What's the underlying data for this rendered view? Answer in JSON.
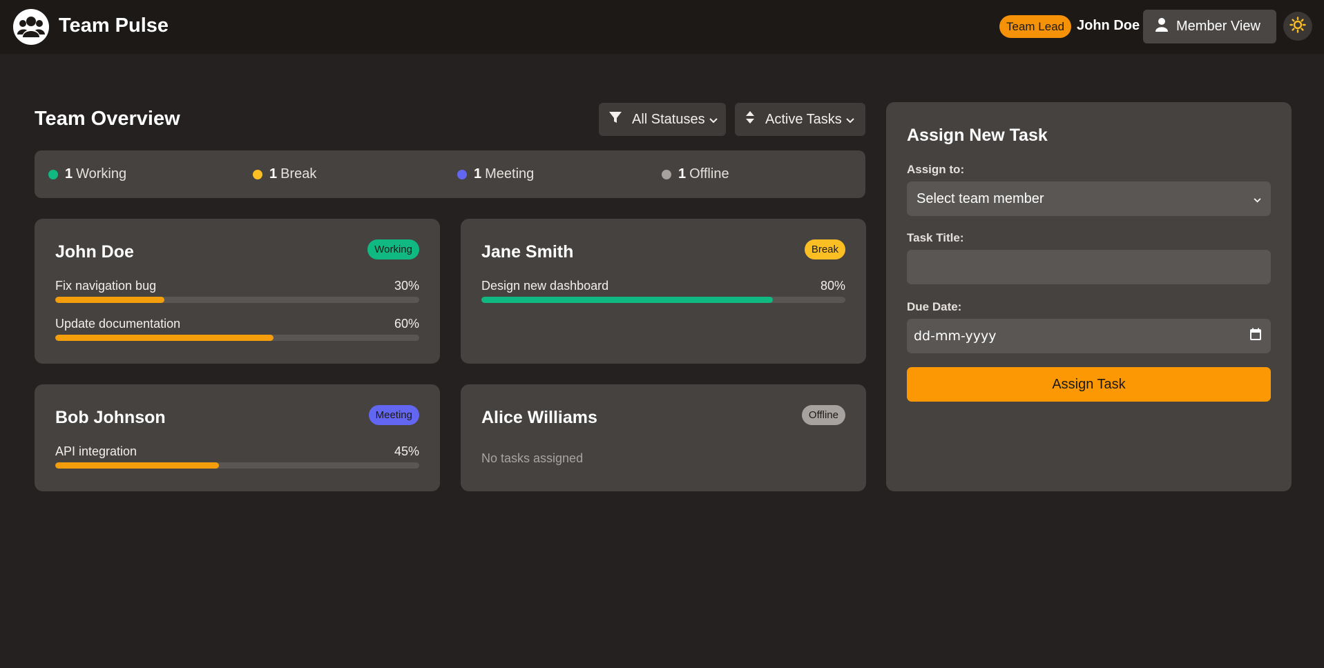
{
  "header": {
    "app_title": "Team Pulse",
    "role_badge": "Team Lead",
    "user_name": "John Doe",
    "view_button_label": "Member View",
    "icons": {
      "logo": "users-icon",
      "view": "user-icon",
      "theme": "sun-icon"
    }
  },
  "overview": {
    "title": "Team Overview",
    "filter_status_label": "All Statuses",
    "filter_sort_label": "Active Tasks",
    "summary": [
      {
        "count": "1",
        "label": "Working",
        "color": "#10b981"
      },
      {
        "count": "1",
        "label": "Break",
        "color": "#fbbf24"
      },
      {
        "count": "1",
        "label": "Meeting",
        "color": "#6366f1"
      },
      {
        "count": "1",
        "label": "Offline",
        "color": "#a8a29e"
      }
    ]
  },
  "members": [
    {
      "name": "John Doe",
      "status": "Working",
      "status_color": "#10b981",
      "tasks": [
        {
          "title": "Fix navigation bug",
          "progress_label": "30%",
          "progress": 30,
          "color": "#f59e0b"
        },
        {
          "title": "Update documentation",
          "progress_label": "60%",
          "progress": 60,
          "color": "#f59e0b"
        }
      ]
    },
    {
      "name": "Jane Smith",
      "status": "Break",
      "status_color": "#fbbf24",
      "tasks": [
        {
          "title": "Design new dashboard",
          "progress_label": "80%",
          "progress": 80,
          "color": "#10b981"
        }
      ]
    },
    {
      "name": "Bob Johnson",
      "status": "Meeting",
      "status_color": "#6366f1",
      "tasks": [
        {
          "title": "API integration",
          "progress_label": "45%",
          "progress": 45,
          "color": "#f59e0b"
        }
      ]
    },
    {
      "name": "Alice Williams",
      "status": "Offline",
      "status_color": "#a8a29e",
      "tasks": [],
      "empty_text": "No tasks assigned"
    }
  ],
  "assign": {
    "title": "Assign New Task",
    "assign_to_label": "Assign to:",
    "assign_to_value": "Select team member",
    "task_title_label": "Task Title:",
    "task_title_value": "",
    "due_date_label": "Due Date:",
    "due_date_placeholder": "dd-mm-yyyy",
    "submit_label": "Assign Task"
  }
}
